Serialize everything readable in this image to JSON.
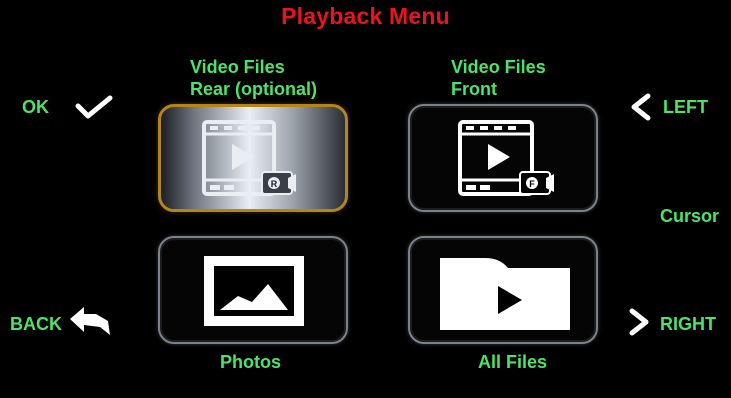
{
  "screen": {
    "title": "Playback Menu"
  },
  "tiles": [
    {
      "label_line1": "Video Files",
      "label_line2": "Rear (optional)",
      "icon": "video-rear-icon",
      "selected": true,
      "camera_badge": "R"
    },
    {
      "label_line1": "Video Files",
      "label_line2": "Front",
      "icon": "video-front-icon",
      "selected": false,
      "camera_badge": "F"
    },
    {
      "label": "Photos",
      "icon": "photo-icon",
      "selected": false
    },
    {
      "label": "All Files",
      "icon": "folder-play-icon",
      "selected": false
    }
  ],
  "hints": {
    "ok": "OK",
    "back": "BACK",
    "left": "LEFT",
    "cursor": "Cursor",
    "right": "RIGHT"
  },
  "colors": {
    "title": "#e8141e",
    "labels": "#4de36a",
    "selected_border": "#b5841a",
    "background": "#000000"
  }
}
